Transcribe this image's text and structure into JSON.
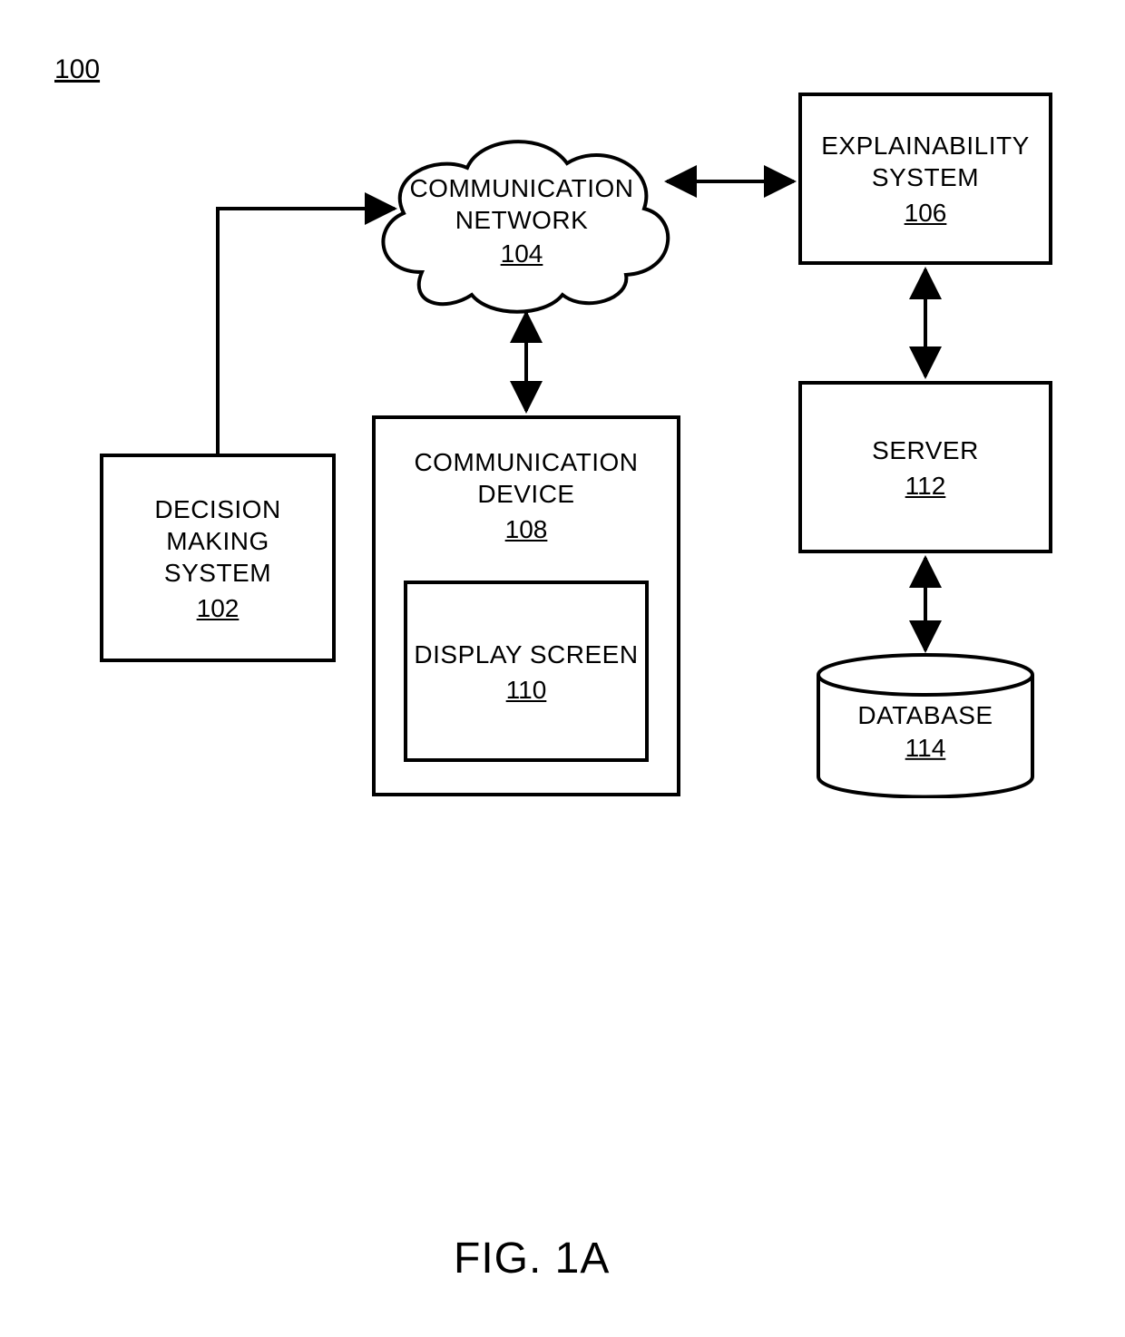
{
  "figure": {
    "overall_ref": "100",
    "label": "FIG. 1A"
  },
  "nodes": {
    "decision_making_system": {
      "title": "DECISION MAKING\nSYSTEM",
      "ref": "102"
    },
    "communication_network": {
      "title": "COMMUNICATION\nNETWORK",
      "ref": "104"
    },
    "explainability_system": {
      "title": "EXPLAINABILITY\nSYSTEM",
      "ref": "106"
    },
    "communication_device": {
      "title": "COMMUNICATION\nDEVICE",
      "ref": "108"
    },
    "display_screen": {
      "title": "DISPLAY SCREEN",
      "ref": "110"
    },
    "server": {
      "title": "SERVER",
      "ref": "112"
    },
    "database": {
      "title": "DATABASE",
      "ref": "114"
    }
  },
  "connections": [
    {
      "from": "decision_making_system",
      "to": "communication_network",
      "bidirectional": false
    },
    {
      "from": "communication_network",
      "to": "explainability_system",
      "bidirectional": true
    },
    {
      "from": "communication_network",
      "to": "communication_device",
      "bidirectional": true
    },
    {
      "from": "explainability_system",
      "to": "server",
      "bidirectional": true
    },
    {
      "from": "server",
      "to": "database",
      "bidirectional": true
    }
  ]
}
